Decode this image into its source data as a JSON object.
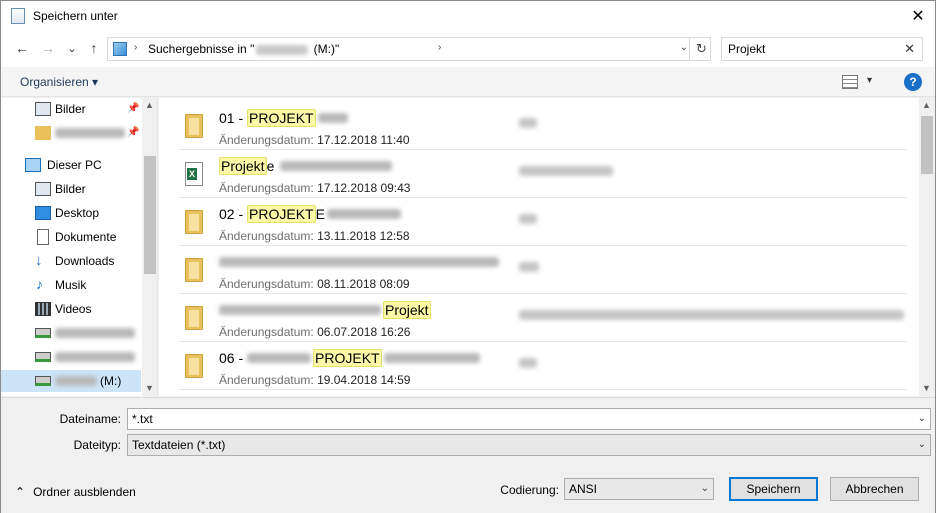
{
  "window": {
    "title": "Speichern unter",
    "close_glyph": "✕"
  },
  "nav": {
    "back_glyph": "←",
    "forward_glyph": "→",
    "recent_glyph": "⌄",
    "up_glyph": "↑",
    "address_prefix": "Suchergebnisse in \"",
    "address_suffix": " (M:)\"",
    "refresh_glyph": "↻"
  },
  "search": {
    "value": "Projekt",
    "clear_glyph": "✕"
  },
  "toolbar": {
    "organize_label": "Organisieren ▾",
    "help_glyph": "?"
  },
  "sidebar": {
    "items": [
      {
        "label": "Bilder",
        "icon": "pictures-icon"
      },
      {
        "label": "",
        "icon": "folder-icon"
      },
      {
        "label": "Dieser PC",
        "icon": "computer-icon"
      },
      {
        "label": "Bilder",
        "icon": "pictures-icon"
      },
      {
        "label": "Desktop",
        "icon": "desktop-icon"
      },
      {
        "label": "Dokumente",
        "icon": "documents-icon"
      },
      {
        "label": "Downloads",
        "icon": "downloads-icon"
      },
      {
        "label": "Musik",
        "icon": "music-icon"
      },
      {
        "label": "Videos",
        "icon": "videos-icon"
      },
      {
        "label": "",
        "icon": "network-drive-icon"
      },
      {
        "label": "",
        "icon": "network-drive-icon"
      },
      {
        "label": "(M:)",
        "icon": "network-drive-icon"
      }
    ]
  },
  "files": [
    {
      "name_pre": "01 - ",
      "name_hl": "PROJEKT",
      "name_post": "",
      "date_label": "Änderungsdatum: ",
      "date": "17.12.2018 11:40",
      "icon": "folder-icon"
    },
    {
      "name_pre": "",
      "name_hl": "Projekt",
      "name_post": "e",
      "date_label": "Änderungsdatum: ",
      "date": "17.12.2018 09:43",
      "icon": "excel-file-icon"
    },
    {
      "name_pre": "02 - ",
      "name_hl": "PROJEKT",
      "name_post": "E",
      "date_label": "Änderungsdatum: ",
      "date": "13.11.2018 12:58",
      "icon": "folder-icon"
    },
    {
      "name_pre": "",
      "name_hl": "",
      "name_post": "",
      "date_label": "Änderungsdatum: ",
      "date": "08.11.2018 08:09",
      "icon": "folder-icon"
    },
    {
      "name_pre": "",
      "name_hl": "Projekt",
      "name_post": "",
      "date_label": "Änderungsdatum: ",
      "date": "06.07.2018 16:26",
      "icon": "folder-icon"
    },
    {
      "name_pre": "06 - ",
      "name_hl": "PROJEKT",
      "name_post": "",
      "date_label": "Änderungsdatum: ",
      "date": "19.04.2018 14:59",
      "icon": "folder-icon"
    }
  ],
  "bottom": {
    "filename_label": "Dateiname:",
    "filename_value": "*.txt",
    "filetype_label": "Dateityp:",
    "filetype_value": "Textdateien (*.txt)",
    "encoding_label": "Codierung:",
    "encoding_value": "ANSI",
    "save_label": "Speichern",
    "cancel_label": "Abbrechen",
    "hide_folders_label": "Ordner ausblenden",
    "hide_glyph": "⌃"
  }
}
